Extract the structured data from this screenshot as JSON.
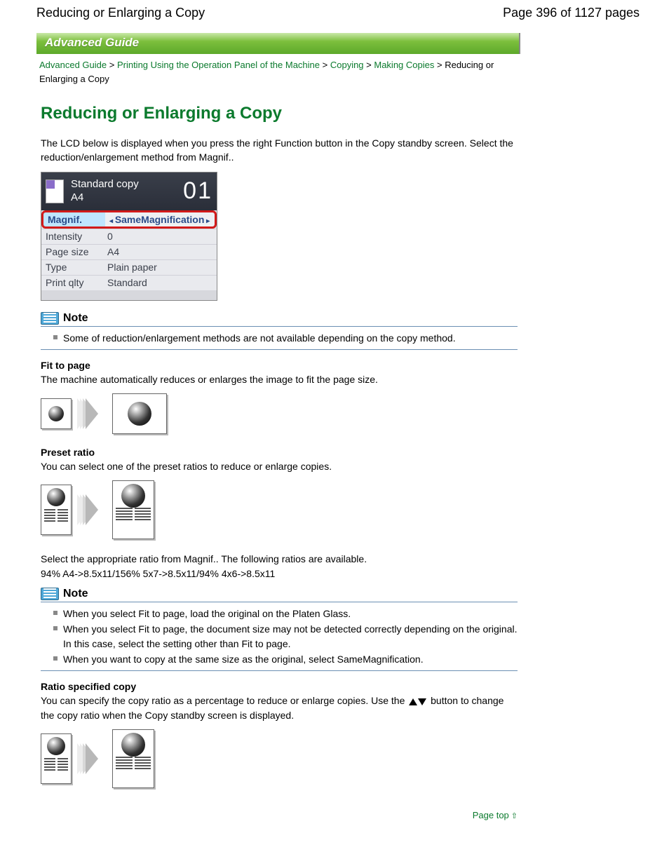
{
  "header": {
    "left_title": "Reducing or Enlarging a Copy",
    "right_pages": "Page 396 of 1127 pages"
  },
  "banner": "Advanced Guide",
  "breadcrumb": {
    "a": "Advanced Guide",
    "b": "Printing Using the Operation Panel of the Machine",
    "c": "Copying",
    "d": "Making Copies",
    "current": "Reducing or Enlarging a Copy"
  },
  "title": "Reducing or Enlarging a Copy",
  "intro": "The LCD below is displayed when you press the right Function button in the Copy standby screen. Select the reduction/enlargement method from Magnif..",
  "lcd": {
    "mode": "Standard copy",
    "size_small": "A4",
    "count": "01",
    "rows": {
      "magnif_k": "Magnif.",
      "magnif_v": "SameMagnification",
      "intensity_k": "Intensity",
      "intensity_v": "0",
      "pagesize_k": "Page size",
      "pagesize_v": "A4",
      "type_k": "Type",
      "type_v": "Plain paper",
      "qlty_k": "Print qlty",
      "qlty_v": "Standard"
    }
  },
  "note_label": "Note",
  "note1_items": [
    "Some of reduction/enlargement methods are not available depending on the copy method."
  ],
  "sections": {
    "fit_head": "Fit to page",
    "fit_body": "The machine automatically reduces or enlarges the image to fit the page size.",
    "preset_head": "Preset ratio",
    "preset_body": "You can select one of the preset ratios to reduce or enlarge copies.",
    "preset_below1": "Select the appropriate ratio from Magnif.. The following ratios are available.",
    "preset_below2": "94% A4->8.5x11/156% 5x7->8.5x11/94% 4x6->8.5x11",
    "ratio_head": "Ratio specified copy",
    "ratio_body_a": "You can specify the copy ratio as a percentage to reduce or enlarge copies. Use the ",
    "ratio_body_b": " button to change the copy ratio when the Copy standby screen is displayed."
  },
  "note2_items": [
    "When you select Fit to page, load the original on the Platen Glass.",
    "When you select Fit to page, the document size may not be detected correctly depending on the original. In this case, select the setting other than Fit to page.",
    "When you want to copy at the same size as the original, select SameMagnification."
  ],
  "page_top": "Page top"
}
